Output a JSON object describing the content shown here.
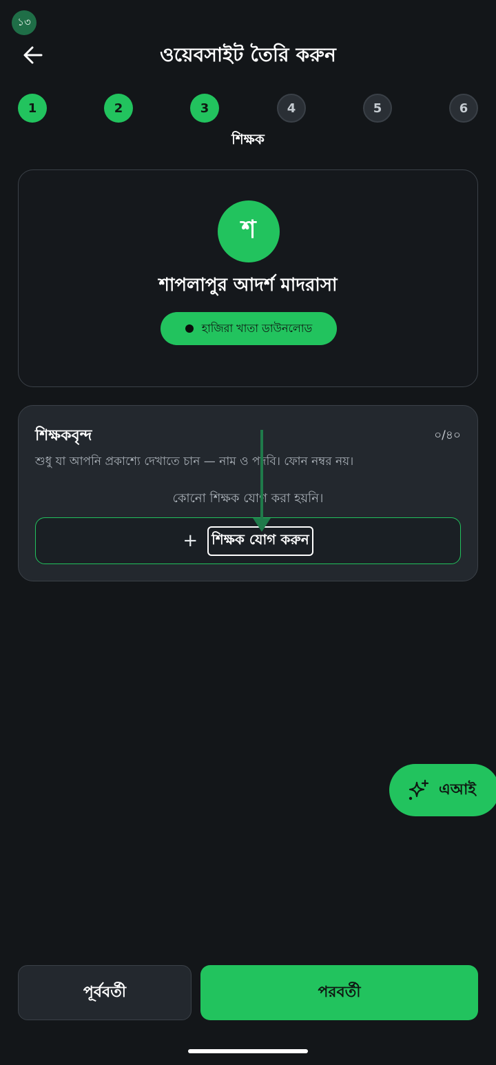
{
  "status_badge": "১৩",
  "header": {
    "title": "ওয়েবসাইট তৈরি করুন"
  },
  "stepper": {
    "steps": [
      "1",
      "2",
      "3",
      "4",
      "5",
      "6"
    ],
    "current_label": "শিক্ষক",
    "completed_count": 3
  },
  "profile": {
    "avatar_letter": "শ",
    "school_name": "শাপলাপুর আদর্শ মাদরাসা",
    "attendance_button": "হাজিরা খাতা ডাউনলোড"
  },
  "teachers": {
    "title": "শিক্ষকবৃন্দ",
    "count": "০/৪০",
    "description": "শুধু যা আপনি প্রকাশ্যে দেখাতে চান — নাম ও পদবি। ফোন নম্বর নয়।",
    "empty_text": "কোনো শিক্ষক যোগ করা হয়নি।",
    "add_button": "শিক্ষক যোগ করুন"
  },
  "fab": {
    "label": "এআই",
    "icon": "sparkles-icon"
  },
  "footer": {
    "prev_label": "পূর্ববর্তী",
    "next_label": "পরবর্তী"
  },
  "colors": {
    "accent": "#22c35e",
    "background": "#131619",
    "card": "#23282e"
  }
}
